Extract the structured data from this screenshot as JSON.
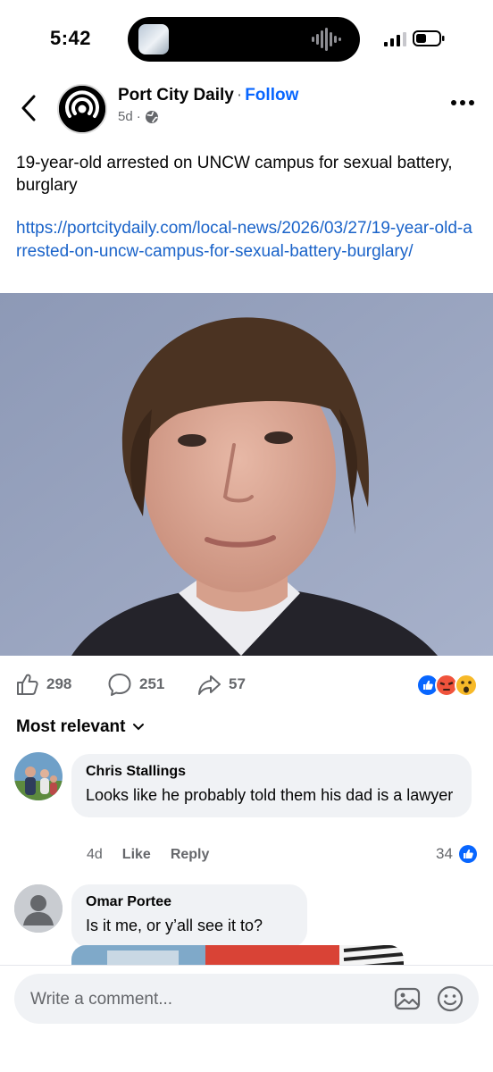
{
  "status_bar": {
    "time": "5:42"
  },
  "post": {
    "page_name": "Follow",
    "page_title": "Port City Daily",
    "follow_label": "Follow",
    "age": "5d",
    "text": "19-year-old arrested on UNCW campus for sexual battery, burglary",
    "link": "https://portcitydaily.com/local-news/2026/03/27/19-year-old-arrested-on-uncw-campus-for-sexual-battery-burglary/"
  },
  "actions": {
    "likes": "298",
    "comments": "251",
    "shares": "57"
  },
  "sort": {
    "label": "Most relevant"
  },
  "comments": [
    {
      "author": "Chris Stallings",
      "text": "Looks like he probably told them his dad is a lawyer",
      "age": "4d",
      "like_label": "Like",
      "reply_label": "Reply",
      "reaction_count": "34"
    },
    {
      "author": "Omar Portee",
      "text": "Is it me, or y’all see it to?"
    }
  ],
  "composer": {
    "placeholder": "Write a comment..."
  },
  "colors": {
    "link": "#1a63c9",
    "follow": "#0866ff",
    "bubble": "#f0f2f5",
    "muted": "#65676b"
  }
}
